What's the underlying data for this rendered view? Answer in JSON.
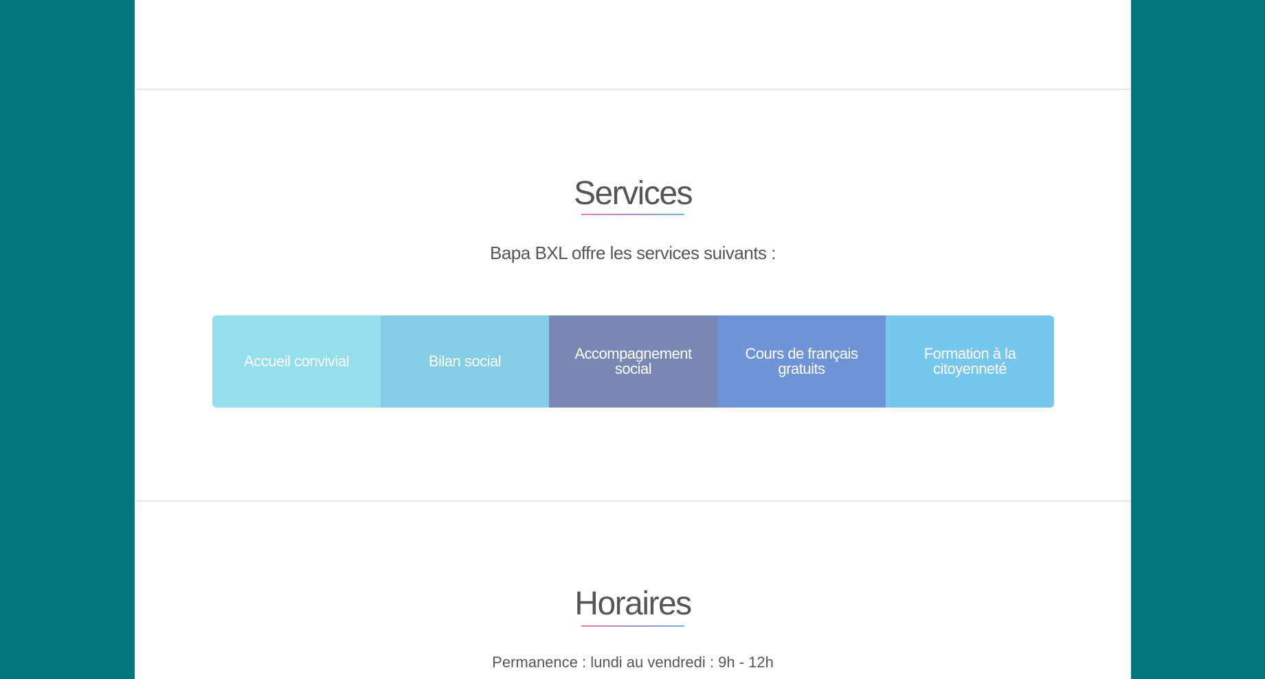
{
  "colors": {
    "outer_background": "#00777c",
    "page_background": "#ffffff",
    "heading_text": "#555555",
    "underline_gradient": [
      "#f07aa0",
      "#a48cc8",
      "#66b4ec"
    ]
  },
  "services": {
    "title": "Services",
    "intro": "Bapa BXL offre les services suivants :",
    "items": [
      {
        "label": "Accueil convivial",
        "color": "#93dfee"
      },
      {
        "label": "Bilan social",
        "color": "#83cde7"
      },
      {
        "label": "Accompagnement social",
        "color": "#7987b5"
      },
      {
        "label": "Cours de français gratuits",
        "color": "#6e93d7"
      },
      {
        "label": "Formation à la citoyenneté",
        "color": "#76c6ee"
      }
    ]
  },
  "horaires": {
    "title": "Horaires",
    "lines": [
      "Permanence : lundi au vendredi : 9h - 12h"
    ]
  }
}
